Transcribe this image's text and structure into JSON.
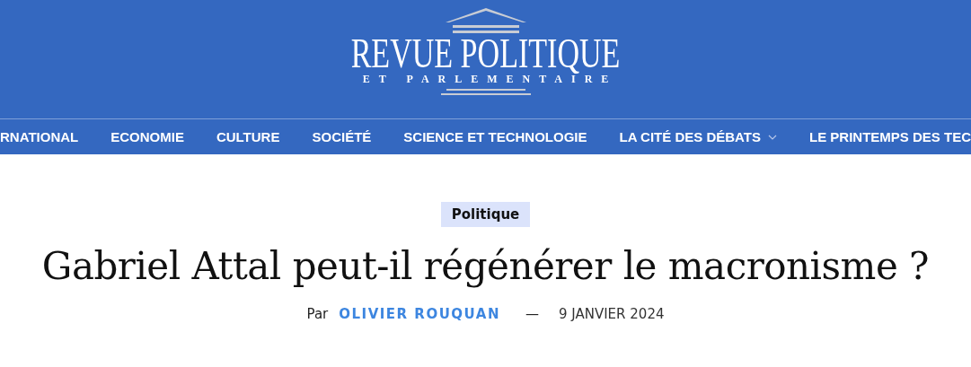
{
  "logo": {
    "title": "REVUE POLITIQUE",
    "subtitle": "ET PARLEMENTAIRE"
  },
  "nav": [
    {
      "label": "RNATIONAL",
      "dropdown": false
    },
    {
      "label": "ECONOMIE",
      "dropdown": false
    },
    {
      "label": "CULTURE",
      "dropdown": false
    },
    {
      "label": "SOCIÉTÉ",
      "dropdown": false
    },
    {
      "label": "SCIENCE ET TECHNOLOGIE",
      "dropdown": false
    },
    {
      "label": "LA CITÉ DES DÉBATS",
      "dropdown": true
    },
    {
      "label": "LE PRINTEMPS DES TEC",
      "dropdown": false
    }
  ],
  "article": {
    "category": "Politique",
    "title": "Gabriel Attal peut-il régénérer le macronisme ?",
    "byline_prefix": "Par",
    "author": "OLIVIER ROUQUAN",
    "separator": "—",
    "date": "9 JANVIER 2024"
  }
}
